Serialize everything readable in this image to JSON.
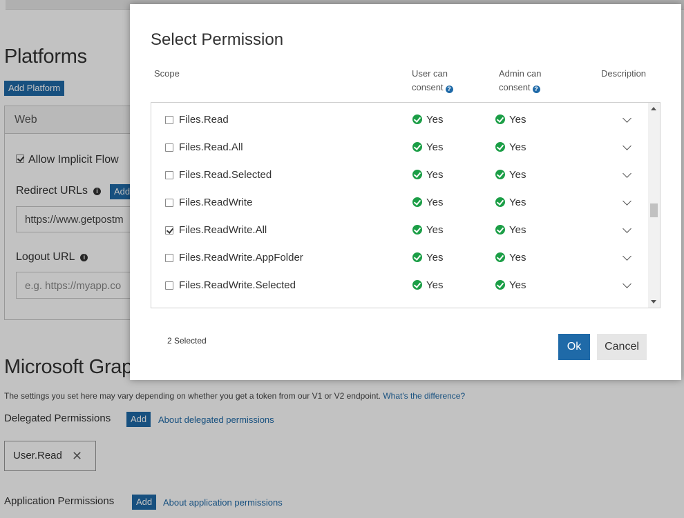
{
  "background": {
    "platforms_heading": "Platforms",
    "add_platform_label": "Add Platform",
    "platform_tab_label": "Web",
    "allow_implicit_flow_label": "Allow Implicit Flow",
    "allow_implicit_flow_checked": true,
    "redirect_urls_label": "Redirect URLs",
    "redirect_add_label": "Add",
    "redirect_url_value": "https://www.getpostm",
    "logout_url_label": "Logout URL",
    "logout_url_placeholder": "e.g. https://myapp.co",
    "graph_heading": "Microsoft Grap",
    "settings_note": "The settings you set here may vary depending on whether you get a token from our V1 or V2 endpoint.",
    "settings_note_link": "What's the difference?",
    "delegated_label": "Delegated Permissions",
    "delegated_add_label": "Add",
    "delegated_about_link": "About delegated permissions",
    "delegated_chip": "User.Read",
    "application_label": "Application Permissions",
    "application_add_label": "Add",
    "application_about_link": "About application permissions"
  },
  "modal": {
    "title": "Select Permission",
    "columns": {
      "scope": "Scope",
      "user_consent_line1": "User can",
      "user_consent_line2": "consent",
      "admin_consent_line1": "Admin can",
      "admin_consent_line2": "consent",
      "description": "Description"
    },
    "rows": [
      {
        "scope": "Files.Read",
        "checked": false,
        "user": "Yes",
        "admin": "Yes"
      },
      {
        "scope": "Files.Read.All",
        "checked": false,
        "user": "Yes",
        "admin": "Yes"
      },
      {
        "scope": "Files.Read.Selected",
        "checked": false,
        "user": "Yes",
        "admin": "Yes"
      },
      {
        "scope": "Files.ReadWrite",
        "checked": false,
        "user": "Yes",
        "admin": "Yes"
      },
      {
        "scope": "Files.ReadWrite.All",
        "checked": true,
        "user": "Yes",
        "admin": "Yes"
      },
      {
        "scope": "Files.ReadWrite.AppFolder",
        "checked": false,
        "user": "Yes",
        "admin": "Yes"
      },
      {
        "scope": "Files.ReadWrite.Selected",
        "checked": false,
        "user": "Yes",
        "admin": "Yes"
      }
    ],
    "selected_count": "2 Selected",
    "ok_label": "Ok",
    "cancel_label": "Cancel"
  }
}
